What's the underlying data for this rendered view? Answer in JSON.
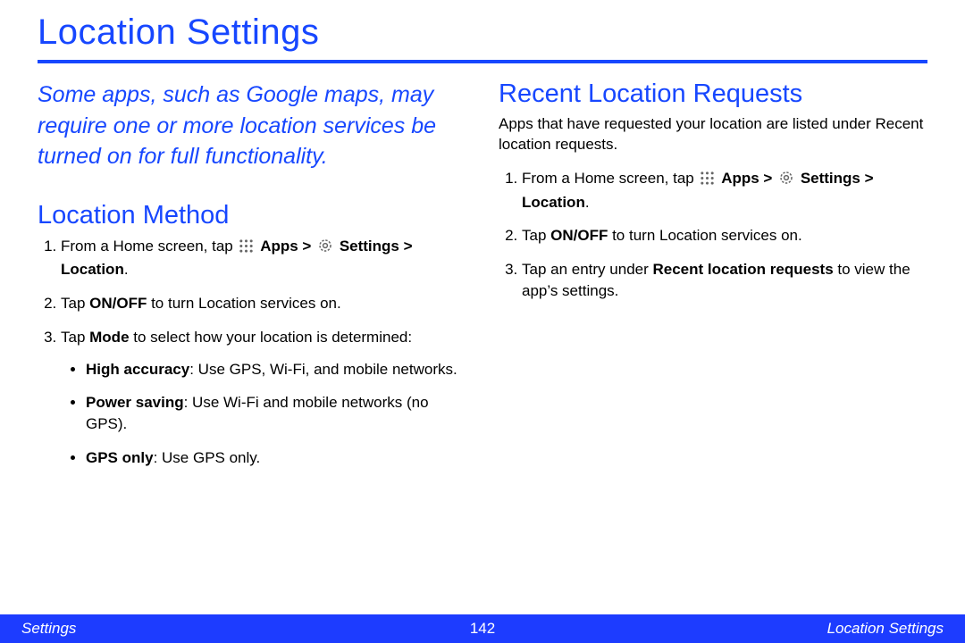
{
  "title": "Location Settings",
  "lead": "Some apps, such as Google maps, may require one or more location services be turned on for full functionality.",
  "left": {
    "heading": "Location Method",
    "step1_a": "From a Home screen, tap ",
    "step1_apps": "Apps > ",
    "step1_settings": "Settings > Location",
    "step1_end": ".",
    "step2_a": "Tap ",
    "step2_b": "ON/OFF",
    "step2_c": " to turn Location services on.",
    "step3_a": "Tap ",
    "step3_b": "Mode",
    "step3_c": " to select how your location is determined:",
    "b1_a": "High accuracy",
    "b1_b": ": Use GPS, Wi-Fi, and mobile networks.",
    "b2_a": "Power saving",
    "b2_b": ": Use Wi-Fi and mobile networks (no GPS).",
    "b3_a": "GPS only",
    "b3_b": ": Use GPS only."
  },
  "right": {
    "heading": "Recent Location Requests",
    "intro": "Apps that have requested your location are listed under Recent location requests.",
    "step1_a": "From a Home screen, tap ",
    "step1_apps": "Apps > ",
    "step1_settings": "Settings > Location",
    "step1_end": ".",
    "step2_a": "Tap ",
    "step2_b": "ON/OFF",
    "step2_c": " to turn Location services on.",
    "step3_a": "Tap an entry under ",
    "step3_b": "Recent location requests",
    "step3_c": " to view the app’s settings."
  },
  "footer": {
    "left": "Settings",
    "page": "142",
    "right": "Location Settings"
  },
  "icons": {
    "apps": "apps-grid-icon",
    "settings": "settings-gear-icon"
  }
}
